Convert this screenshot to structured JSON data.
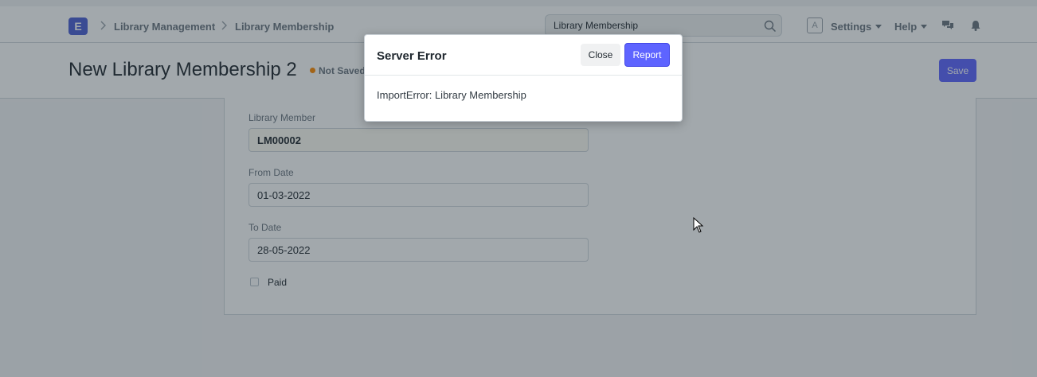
{
  "navbar": {
    "logo_letter": "E",
    "breadcrumbs": [
      "Library Management",
      "Library Membership"
    ],
    "search_value": "Library Membership",
    "avatar_letter": "A",
    "settings_label": "Settings",
    "help_label": "Help"
  },
  "page": {
    "title": "New Library Membership 2",
    "status": "Not Saved",
    "save_label": "Save"
  },
  "form": {
    "library_member": {
      "label": "Library Member",
      "value": "LM00002"
    },
    "from_date": {
      "label": "From Date",
      "value": "01-03-2022"
    },
    "to_date": {
      "label": "To Date",
      "value": "28-05-2022"
    },
    "paid": {
      "label": "Paid",
      "checked": false
    }
  },
  "dialog": {
    "title": "Server Error",
    "close_label": "Close",
    "report_label": "Report",
    "message": "ImportError: Library Membership"
  },
  "colors": {
    "primary": "#5e64ff",
    "logo": "#4c5fd5",
    "not_saved_dot": "#ff8a00"
  },
  "icons": [
    "search-icon",
    "chevron-right-icon",
    "chat-icon",
    "bell-icon",
    "cursor-icon"
  ]
}
